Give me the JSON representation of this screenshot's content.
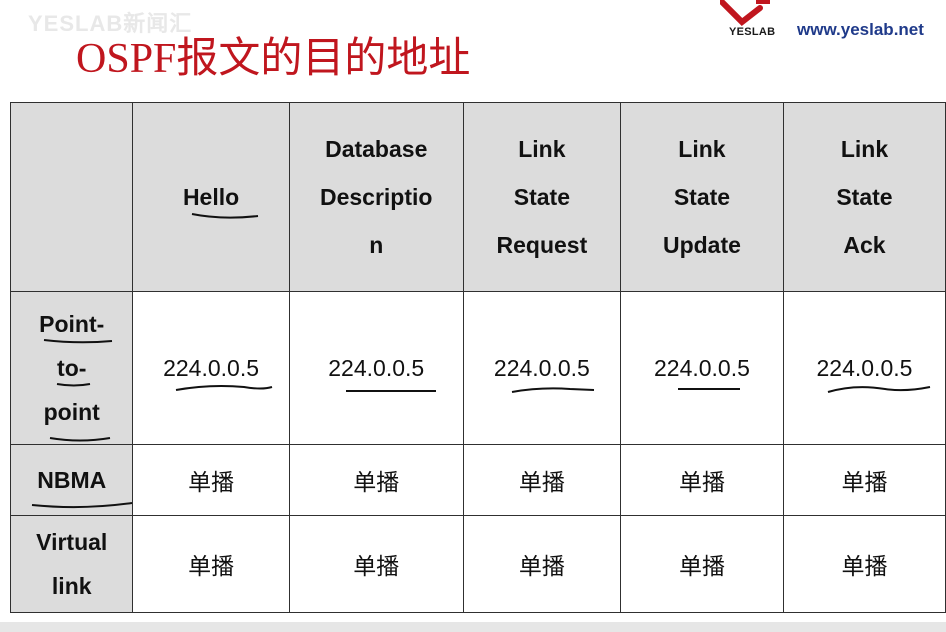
{
  "watermark": "YESLAB新闻汇",
  "title": "OSPF报文的目的地址",
  "brand": {
    "logo_text": "YESLAB",
    "site": "www.yeslab.net"
  },
  "table": {
    "columns": [
      "",
      "Hello",
      "Database\nDescriptio\nn",
      "Link\nState\nRequest",
      "Link\nState\nUpdate",
      "Link\nState\nAck"
    ],
    "rows": [
      {
        "label": "Point-\nto-\npoint",
        "cells": [
          "224.0.0.5",
          "224.0.0.5",
          "224.0.0.5",
          "224.0.0.5",
          "224.0.0.5"
        ]
      },
      {
        "label": "NBMA",
        "cells": [
          "单播",
          "单播",
          "单播",
          "单播",
          "单播"
        ]
      },
      {
        "label": "Virtual\nlink",
        "cells": [
          "单播",
          "单播",
          "单播",
          "单播",
          "单播"
        ]
      }
    ]
  },
  "colors": {
    "title": "#c0161e",
    "header_bg": "#dcdcdc",
    "site": "#1f3a8a"
  }
}
